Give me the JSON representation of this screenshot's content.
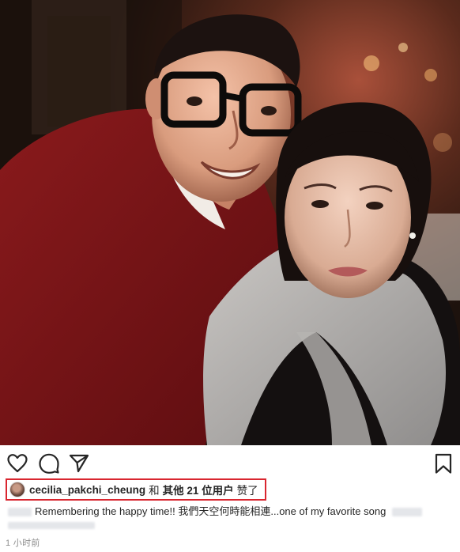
{
  "post": {
    "actions": {
      "like_icon": "heart-outline-icon",
      "comment_icon": "comment-bubble-icon",
      "share_icon": "paper-plane-icon",
      "save_icon": "bookmark-icon"
    },
    "likes": {
      "username": "cecilia_pakchi_cheung",
      "and": "和",
      "others": "其他 21 位用户",
      "verb": "赞了"
    },
    "caption": {
      "text": "Remembering the happy time!! 我們天空何時能相連...one of my favorite song"
    },
    "timestamp": "1 小时前"
  },
  "colors": {
    "highlight_border": "#d9262f",
    "text": "#262626",
    "muted": "#8e8e8e"
  }
}
